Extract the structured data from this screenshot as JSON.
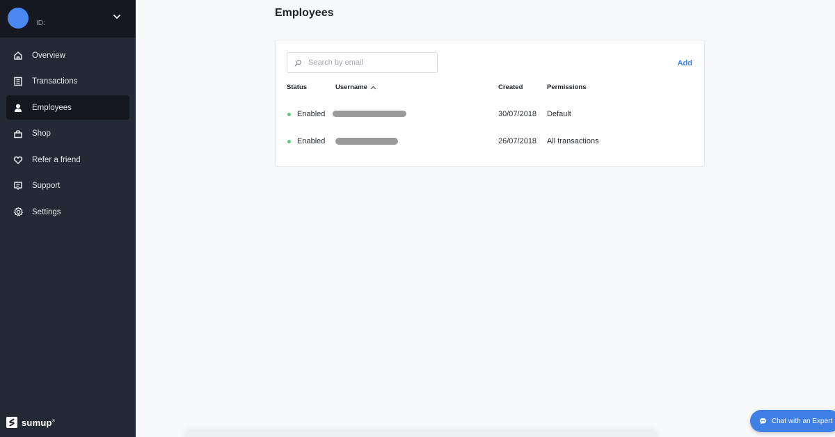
{
  "account": {
    "id_label": "ID:",
    "avatar_color": "#4b87f0"
  },
  "sidebar": {
    "items": [
      {
        "label": "Overview",
        "icon": "home-icon",
        "active": false
      },
      {
        "label": "Transactions",
        "icon": "receipt-icon",
        "active": false
      },
      {
        "label": "Employees",
        "icon": "person-icon",
        "active": true
      },
      {
        "label": "Shop",
        "icon": "shopping-bag-icon",
        "active": false
      },
      {
        "label": "Refer a friend",
        "icon": "heart-icon",
        "active": false
      },
      {
        "label": "Support",
        "icon": "chat-bubble-icon",
        "active": false
      },
      {
        "label": "Settings",
        "icon": "gear-icon",
        "active": false
      }
    ],
    "logo_text": "sumup",
    "logo_reg": "®"
  },
  "main": {
    "title": "Employees",
    "search": {
      "placeholder": "Search by email",
      "value": ""
    },
    "add_label": "Add",
    "table": {
      "columns": [
        "Status",
        "Username",
        "Created",
        "Permissions"
      ],
      "sorted_column": "Username",
      "sort_direction": "ascending",
      "rows": [
        {
          "status": "Enabled",
          "username": "[redacted]",
          "created": "30/07/2018",
          "permissions": "Default"
        },
        {
          "status": "Enabled",
          "username": "[redacted]",
          "created": "26/07/2018",
          "permissions": "All transactions"
        }
      ]
    }
  },
  "chat": {
    "label": "Chat with an Expert"
  },
  "colors": {
    "accent": "#3e84dc",
    "status_enabled": "#5fc87a",
    "sidebar_bg": "#232a36",
    "chat_bg": "#3f7fe8"
  }
}
